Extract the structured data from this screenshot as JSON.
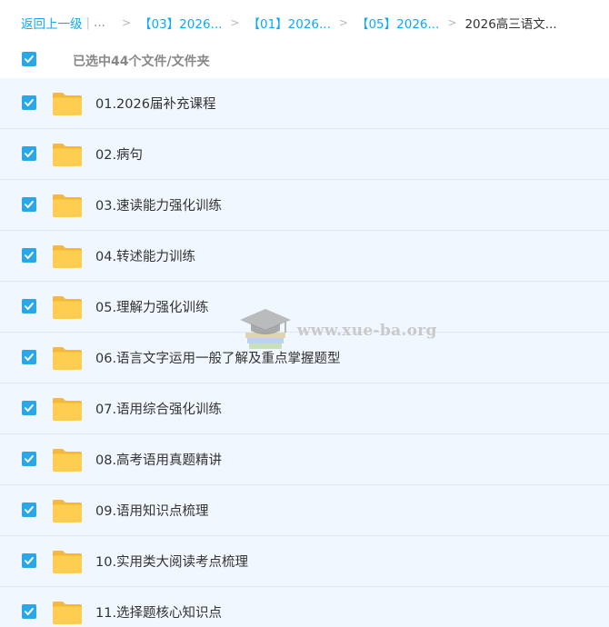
{
  "breadcrumb": {
    "back_label": "返回上一级",
    "pipe": "|",
    "ellipsis": "...",
    "separator": ">",
    "crumbs": [
      "【03】2026...",
      "【01】2026...",
      "【05】2026..."
    ],
    "current": "2026高三语文..."
  },
  "selection": {
    "label": "已选中44个文件/文件夹",
    "checked": true
  },
  "files": [
    {
      "name": "01.2026届补充课程",
      "checked": true,
      "icon": "folder-icon"
    },
    {
      "name": "02.病句",
      "checked": true,
      "icon": "folder-icon"
    },
    {
      "name": "03.速读能力强化训练",
      "checked": true,
      "icon": "folder-icon"
    },
    {
      "name": "04.转述能力训练",
      "checked": true,
      "icon": "folder-icon"
    },
    {
      "name": "05.理解力强化训练",
      "checked": true,
      "icon": "folder-icon"
    },
    {
      "name": "06.语言文字运用一般了解及重点掌握题型",
      "checked": true,
      "icon": "folder-icon"
    },
    {
      "name": "07.语用综合强化训练",
      "checked": true,
      "icon": "folder-icon"
    },
    {
      "name": "08.高考语用真题精讲",
      "checked": true,
      "icon": "folder-icon"
    },
    {
      "name": "09.语用知识点梳理",
      "checked": true,
      "icon": "folder-icon"
    },
    {
      "name": "10.实用类大阅读考点梳理",
      "checked": true,
      "icon": "folder-icon"
    },
    {
      "name": "11.选择题核心知识点",
      "checked": true,
      "icon": "folder-icon"
    }
  ],
  "watermark": {
    "text": "www.xue-ba.org"
  },
  "colors": {
    "accent": "#09aaff",
    "checkbox": "#2aa7e8",
    "row_background": "#f1f7fe",
    "folder": "#ffc94a"
  }
}
